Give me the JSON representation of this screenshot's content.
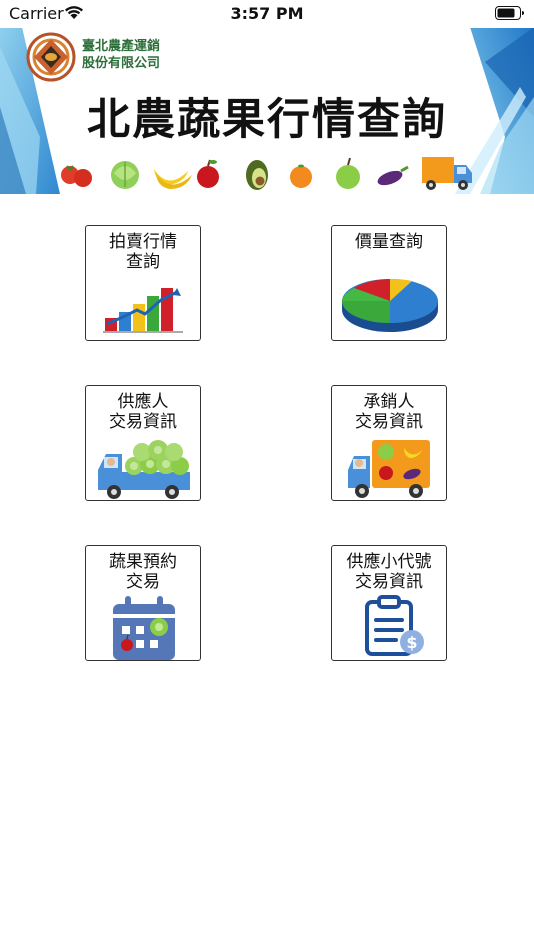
{
  "status_bar": {
    "carrier": "Carrier",
    "time": "3:57 PM"
  },
  "banner": {
    "company_line1": "臺北農產運銷",
    "company_line2": "股份有限公司",
    "title": "北農蔬果行情查詢"
  },
  "menu": [
    {
      "label_line1": "拍賣行情",
      "label_line2": "查詢",
      "icon": "bar-chart-icon"
    },
    {
      "label_line1": "價量查詢",
      "label_line2": "",
      "icon": "pie-chart-icon"
    },
    {
      "label_line1": "供應人",
      "label_line2": "交易資訊",
      "icon": "cabbage-truck-icon"
    },
    {
      "label_line1": "承銷人",
      "label_line2": "交易資訊",
      "icon": "produce-truck-icon"
    },
    {
      "label_line1": "蔬果預約",
      "label_line2": "交易",
      "icon": "calendar-icon"
    },
    {
      "label_line1": "供應小代號",
      "label_line2": "交易資訊",
      "icon": "clipboard-dollar-icon"
    }
  ],
  "colors": {
    "banner_blue": "#3a8fd6",
    "company_text": "#2c6f3a",
    "tile_border": "#333333",
    "truck_blue": "#4a90d9",
    "calendar_blue": "#5577b8"
  }
}
